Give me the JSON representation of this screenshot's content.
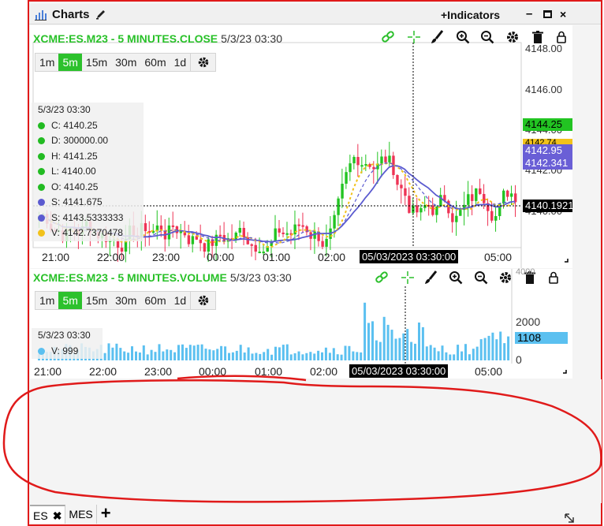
{
  "window": {
    "title": "Charts",
    "indicators_label": "+Indicators",
    "minimize": "–",
    "close": "×"
  },
  "price_pane": {
    "symbol": "XCME:ES.M23 - 5 MINUTES.CLOSE",
    "datetime": "5/3/23 03:30",
    "timeframes": [
      "1m",
      "5m",
      "15m",
      "30m",
      "60m",
      "1d"
    ],
    "active_timeframe": "5m",
    "legend": {
      "date": "5/3/23 03:30",
      "rows": [
        {
          "label": "C: 4140.25",
          "color": "#22bb22"
        },
        {
          "label": "D: 300000.00",
          "color": "#22bb22"
        },
        {
          "label": "H: 4141.25",
          "color": "#22bb22"
        },
        {
          "label": "L: 4140.00",
          "color": "#22bb22"
        },
        {
          "label": "O: 4140.25",
          "color": "#22bb22"
        },
        {
          "label": "S: 4141.675",
          "color": "#5b5bd0"
        },
        {
          "label": "S: 4143.5333333",
          "color": "#5b5bd0"
        },
        {
          "label": "V: 4142.7370478",
          "color": "#f2c21b"
        }
      ]
    },
    "y_axis": [
      "4148.00",
      "4146.00",
      "4144.00",
      "4142.00",
      "4140.00"
    ],
    "price_tags": [
      {
        "text": "4144.25",
        "bg": "#22c422",
        "fg": "#000000"
      },
      {
        "text": "4142.74",
        "bg": "#f2c21b",
        "fg": "#000000"
      },
      {
        "text": "4142.95",
        "bg": "#6a5fd6",
        "fg": "#ffffff"
      },
      {
        "text": "4142.341",
        "bg": "#6a5fd6",
        "fg": "#ffffff"
      },
      {
        "text": "4140.1921",
        "bg": "#000000",
        "fg": "#ffffff"
      }
    ],
    "x_axis": [
      "21:00",
      "22:00",
      "23:00",
      "00:00",
      "01:00",
      "02:00",
      "05:00"
    ],
    "cursor_time": "05/03/2023 03:30:00"
  },
  "volume_pane": {
    "symbol": "XCME:ES.M23 - 5 MINUTES.VOLUME",
    "datetime": "5/3/23 03:30",
    "timeframes": [
      "1m",
      "5m",
      "15m",
      "30m",
      "60m",
      "1d"
    ],
    "active_timeframe": "5m",
    "legend": {
      "date": "5/3/23 03:30",
      "value": "V: 999"
    },
    "y_axis": [
      "4000",
      "2000",
      "0"
    ],
    "volume_tag": "1108",
    "x_axis": [
      "21:00",
      "22:00",
      "23:00",
      "00:00",
      "01:00",
      "02:00",
      "05:00"
    ],
    "cursor_time": "05/03/2023 03:30:00"
  },
  "tabs": [
    {
      "label": "ES",
      "active": true
    },
    {
      "label": "MES",
      "active": false
    }
  ],
  "add_tab": "+",
  "colors": {
    "up": "#22c422",
    "down": "#ee3355",
    "sma": "#5b5bd0",
    "vwap": "#f2c21b",
    "volume": "#5bc0f0",
    "symbol": "#29c129",
    "annotation": "#e01a1a"
  }
}
